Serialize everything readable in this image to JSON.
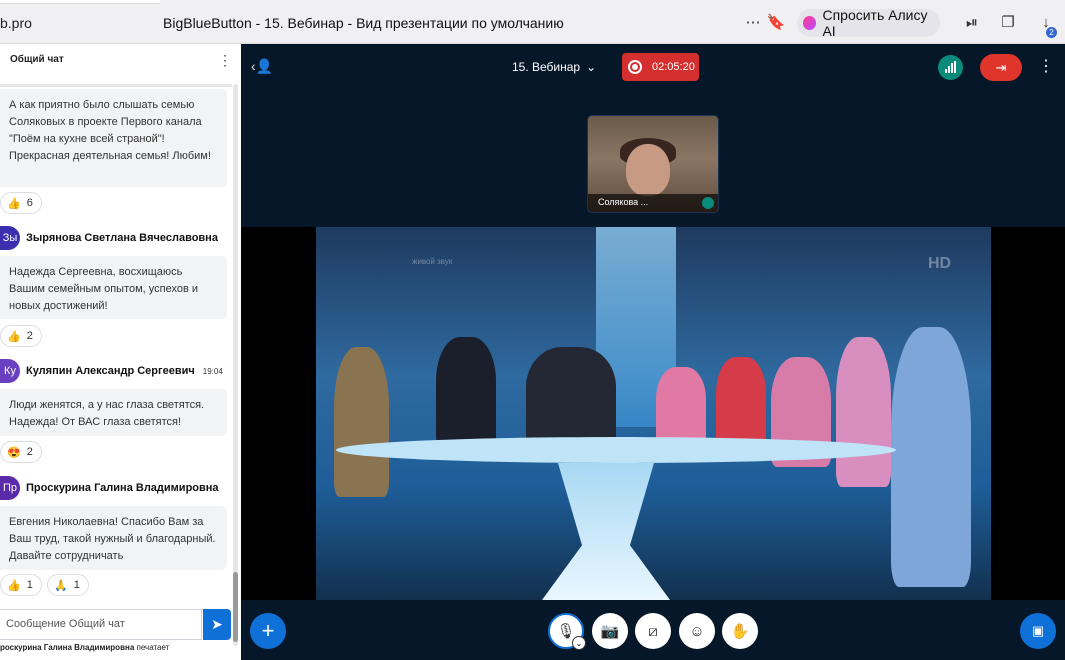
{
  "browser": {
    "url_fragment": "b.pro",
    "page_title": "BigBlueButton - 15. Вебинар - Вид презентации по умолчанию",
    "alice_label": "Спросить Алису AI",
    "download_badge": "2",
    "icons": [
      "more-icon",
      "bookmark-icon",
      "alice-icon",
      "media-icon",
      "bookmarks-panel-icon",
      "download-icon"
    ]
  },
  "chat": {
    "header": "Общий чат",
    "messages": [
      {
        "text": "А как приятно было слышать семью Соляковых в проекте Первого канала \"Поём на кухне всей страной\"! Прекрасная деятельная семья! Любим!",
        "reactions": [
          {
            "emoji": "👍",
            "count": "6"
          }
        ]
      },
      {
        "author": "Зырянова Светлана Вячеславовна",
        "initials": "Зы",
        "color": "#3a2fae",
        "time": "",
        "text": "Надежда Сергеевна, восхищаюсь Вашим семейным опытом, успехов и новых достижений!",
        "reactions": [
          {
            "emoji": "👍",
            "count": "2"
          }
        ]
      },
      {
        "author": "Куляпин Александр Сергеевич",
        "initials": "Ку",
        "color": "#6a3fc1",
        "time": "19:04",
        "text": "Люди женятся, а у нас глаза светятся. Надежда! От ВАС глаза светятся!",
        "reactions": [
          {
            "emoji": "😍",
            "count": "2"
          }
        ]
      },
      {
        "author": "Проскурина Галина Владимировна",
        "initials": "Пр",
        "color": "#5b2aa8",
        "time": "",
        "text": "Евгения Николаевна! Спасибо Вам за Ваш труд, такой нужный и благодарный. Давайте сотрудничать",
        "reactions": [
          {
            "emoji": "👍",
            "count": "1"
          },
          {
            "emoji": "🙏",
            "count": "1"
          }
        ]
      }
    ],
    "composer_placeholder": "Сообщение Общий чат",
    "typing_name": "роскурина Галина Владимировна",
    "typing_suffix": "печатает"
  },
  "meeting": {
    "title": "15. Вебинар",
    "recording_time": "02:05:20",
    "webcam_name": "Солякова ...",
    "video_watermark_hd": "HD",
    "video_watermark_live": "живой звук"
  },
  "colors": {
    "meeting_bg": "#06172a",
    "accent_blue": "#0f70d7",
    "record_red": "#d42e2e",
    "leave_red": "#e0352b",
    "connection_green": "#0a8a7a"
  }
}
